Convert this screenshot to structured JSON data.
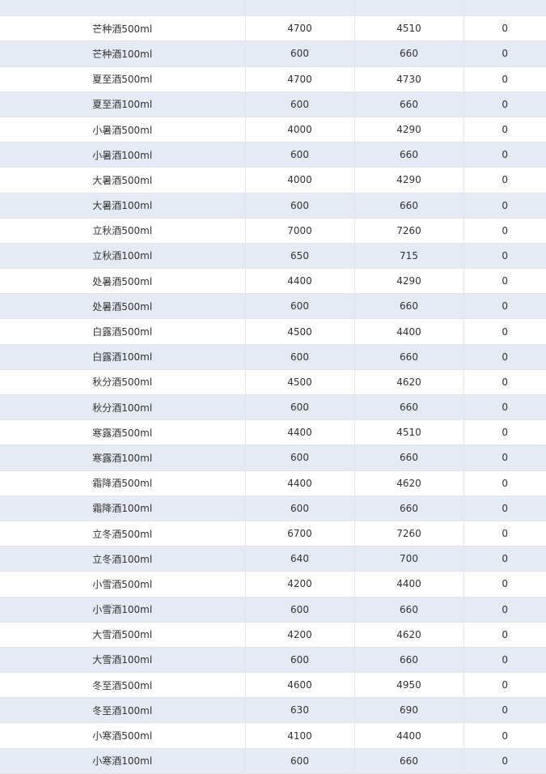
{
  "table": {
    "rows": [
      {
        "name": "",
        "a": "",
        "b": "",
        "c": ""
      },
      {
        "name": "芒种酒500ml",
        "a": "4700",
        "b": "4510",
        "c": "0"
      },
      {
        "name": "芒种酒100ml",
        "a": "600",
        "b": "660",
        "c": "0"
      },
      {
        "name": "夏至酒500ml",
        "a": "4700",
        "b": "4730",
        "c": "0"
      },
      {
        "name": "夏至酒100ml",
        "a": "600",
        "b": "660",
        "c": "0"
      },
      {
        "name": "小暑酒500ml",
        "a": "4000",
        "b": "4290",
        "c": "0"
      },
      {
        "name": "小暑酒100ml",
        "a": "600",
        "b": "660",
        "c": "0"
      },
      {
        "name": "大暑酒500ml",
        "a": "4000",
        "b": "4290",
        "c": "0"
      },
      {
        "name": "大暑酒100ml",
        "a": "600",
        "b": "660",
        "c": "0"
      },
      {
        "name": "立秋酒500ml",
        "a": "7000",
        "b": "7260",
        "c": "0"
      },
      {
        "name": "立秋酒100ml",
        "a": "650",
        "b": "715",
        "c": "0"
      },
      {
        "name": "处暑酒500ml",
        "a": "4400",
        "b": "4290",
        "c": "0"
      },
      {
        "name": "处暑酒500ml",
        "a": "600",
        "b": "660",
        "c": "0"
      },
      {
        "name": "白露酒500ml",
        "a": "4500",
        "b": "4400",
        "c": "0"
      },
      {
        "name": "白露酒100ml",
        "a": "600",
        "b": "660",
        "c": "0"
      },
      {
        "name": "秋分酒500ml",
        "a": "4500",
        "b": "4620",
        "c": "0"
      },
      {
        "name": "秋分酒100ml",
        "a": "600",
        "b": "660",
        "c": "0"
      },
      {
        "name": "寒露酒500ml",
        "a": "4400",
        "b": "4510",
        "c": "0"
      },
      {
        "name": "寒露酒100ml",
        "a": "600",
        "b": "660",
        "c": "0"
      },
      {
        "name": "霜降酒500ml",
        "a": "4400",
        "b": "4620",
        "c": "0"
      },
      {
        "name": "霜降酒100ml",
        "a": "600",
        "b": "660",
        "c": "0"
      },
      {
        "name": "立冬酒500ml",
        "a": "6700",
        "b": "7260",
        "c": "0"
      },
      {
        "name": "立冬酒100ml",
        "a": "640",
        "b": "700",
        "c": "0"
      },
      {
        "name": "小雪酒500ml",
        "a": "4200",
        "b": "4400",
        "c": "0"
      },
      {
        "name": "小雪酒100ml",
        "a": "600",
        "b": "660",
        "c": "0"
      },
      {
        "name": "大雪酒500ml",
        "a": "4200",
        "b": "4620",
        "c": "0"
      },
      {
        "name": "大雪酒100ml",
        "a": "600",
        "b": "660",
        "c": "0"
      },
      {
        "name": "冬至酒500ml",
        "a": "4600",
        "b": "4950",
        "c": "0"
      },
      {
        "name": "冬至酒100ml",
        "a": "630",
        "b": "690",
        "c": "0"
      },
      {
        "name": "小寒酒500ml",
        "a": "4100",
        "b": "4400",
        "c": "0"
      },
      {
        "name": "小寒酒100ml",
        "a": "600",
        "b": "660",
        "c": "0"
      }
    ]
  }
}
